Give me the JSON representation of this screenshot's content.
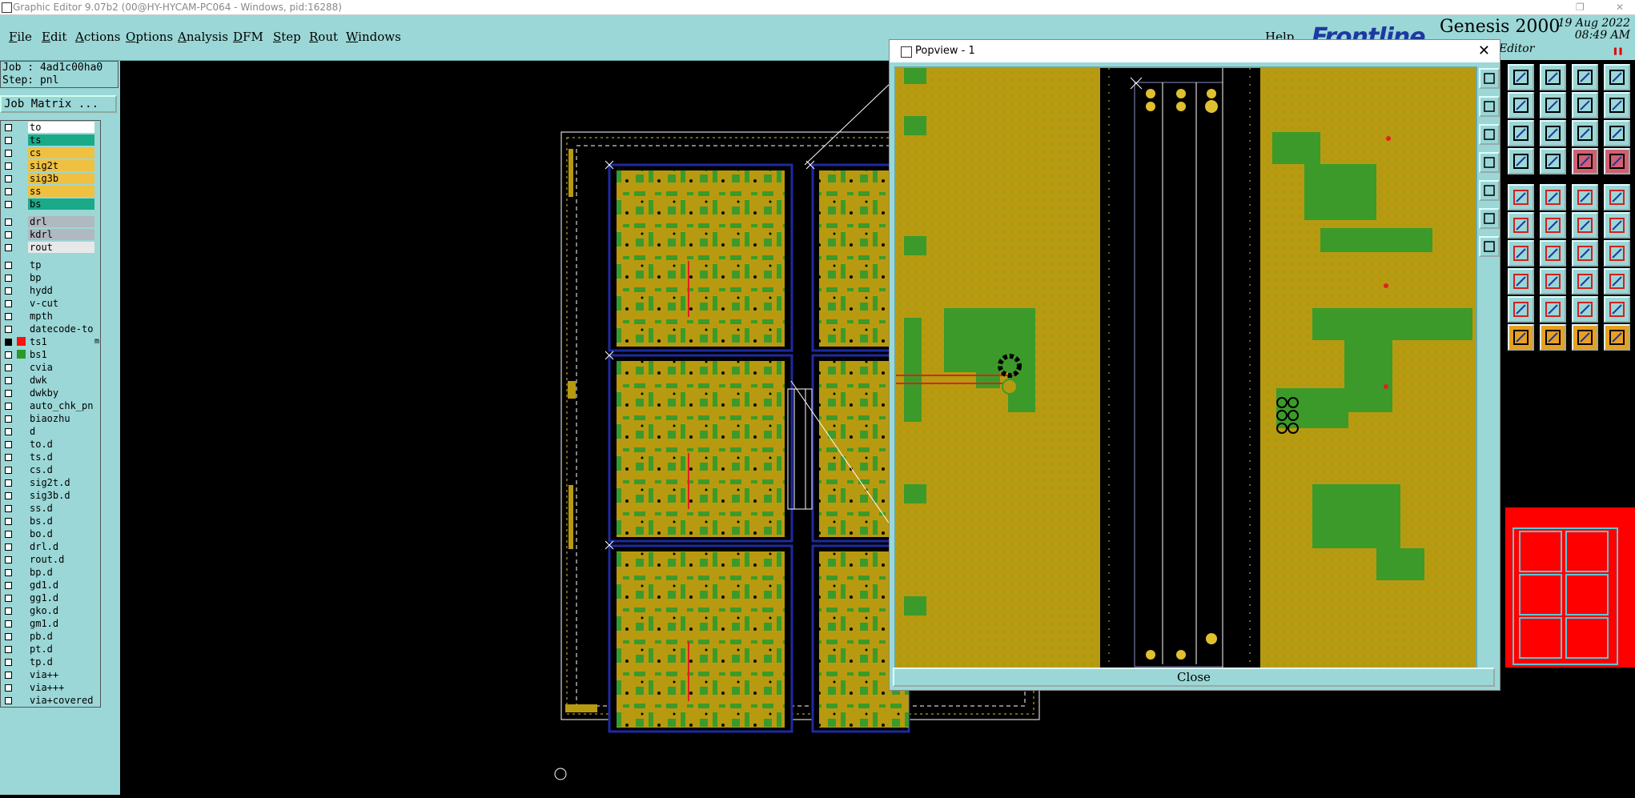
{
  "window": {
    "title": "Graphic Editor 9.07b2 (00@HY-HYCAM-PC064 - Windows, pid:16288)"
  },
  "menu": [
    "File",
    "Edit",
    "Actions",
    "Options",
    "Analysis",
    "DFM",
    "Step",
    "Rout",
    "Windows"
  ],
  "help_label": "Help",
  "brand": {
    "logo": "Frontline",
    "product": "Genesis 2000",
    "date": "19  Aug 2022",
    "time": "08:49  AM",
    "editor": "Editor"
  },
  "job": {
    "job_line": "Job : 4ad1c00ha0",
    "step_line": "Step: pnl"
  },
  "job_matrix_label": "Job Matrix ...",
  "layers_a": [
    {
      "name": "to",
      "color": "#ffffff"
    },
    {
      "name": "ts",
      "color": "#1aaa88"
    },
    {
      "name": "cs",
      "color": "#f0c040"
    },
    {
      "name": "sig2t",
      "color": "#f0c040"
    },
    {
      "name": "sig3b",
      "color": "#f0c040"
    },
    {
      "name": "ss",
      "color": "#f0c040"
    },
    {
      "name": "bs",
      "color": "#1aaa88"
    }
  ],
  "layers_b": [
    {
      "name": "drl",
      "color": "#b0b8c0"
    },
    {
      "name": "kdrl",
      "color": "#b0b8c0"
    },
    {
      "name": "rout",
      "color": "#e8e8e8"
    }
  ],
  "layers_c": [
    {
      "name": "tp"
    },
    {
      "name": "bp"
    },
    {
      "name": "hydd"
    },
    {
      "name": "v-cut"
    },
    {
      "name": "mpth"
    },
    {
      "name": "datecode-to"
    },
    {
      "name": "ts1",
      "active": true,
      "swatch": "#ff1010",
      "mark": "m"
    },
    {
      "name": "bs1",
      "swatch": "#2a9a2a"
    },
    {
      "name": "cvia"
    },
    {
      "name": "dwk"
    },
    {
      "name": "dwkby"
    },
    {
      "name": "auto_chk_pn"
    },
    {
      "name": "biaozhu"
    },
    {
      "name": "d"
    },
    {
      "name": "to.d"
    },
    {
      "name": "ts.d"
    },
    {
      "name": "cs.d"
    },
    {
      "name": "sig2t.d"
    },
    {
      "name": "sig3b.d"
    },
    {
      "name": "ss.d"
    },
    {
      "name": "bs.d"
    },
    {
      "name": "bo.d"
    },
    {
      "name": "drl.d"
    },
    {
      "name": "rout.d"
    },
    {
      "name": "bp.d"
    },
    {
      "name": "gd1.d"
    },
    {
      "name": "gg1.d"
    },
    {
      "name": "gko.d"
    },
    {
      "name": "gm1.d"
    },
    {
      "name": "pb.d"
    },
    {
      "name": "pt.d"
    },
    {
      "name": "tp.d"
    },
    {
      "name": "via++"
    },
    {
      "name": "via+++"
    },
    {
      "name": "via+covered"
    }
  ],
  "popup": {
    "title": "Popview - 1",
    "close_label": "Close"
  },
  "colors": {
    "teal": "#9bd7d7",
    "copper": "#b89a10",
    "green": "#3c9a2a",
    "outline": "#1e2aa0"
  },
  "icons": {
    "popview_tools": [
      "zoom-box-icon",
      "zoom-in-icon",
      "zoom-out-icon",
      "zoom-home-icon",
      "pan-icon",
      "fit-icon",
      "refresh-icon"
    ],
    "tool_rows": [
      [
        "view-up-icon",
        "view-down-icon",
        "home-view-icon",
        "grid-view-icon"
      ],
      [
        "view-left-icon",
        "view-right-icon",
        "zoom-back-icon",
        "snap-icon"
      ],
      [
        "zoom-fit-icon",
        "zoom-extents-icon",
        "scale-1-2-icon",
        "help-icon"
      ],
      [
        "ruler-icon",
        "grid-toggle-icon",
        "measure-icon",
        "measure-select-icon"
      ],
      [
        "pad-icon",
        "line-draw-icon",
        "slot-icon",
        "circle-icon"
      ],
      [
        "connect-pads-icon",
        "cross-icon",
        "rotate-snap-icon",
        "arc-node-icon"
      ],
      [
        "angle-icon",
        "line-icon",
        "rotate-icon",
        "mirror-icon"
      ],
      [
        "move-icon",
        "dash-icon",
        "align-icon",
        "array-icon"
      ],
      [
        "text-a-icon",
        "text-b-icon",
        "text-c-icon",
        "text-d-icon"
      ],
      [
        "select-arrow-icon",
        "select-plus-icon",
        "select-box-icon",
        "select-multi-icon"
      ]
    ]
  }
}
